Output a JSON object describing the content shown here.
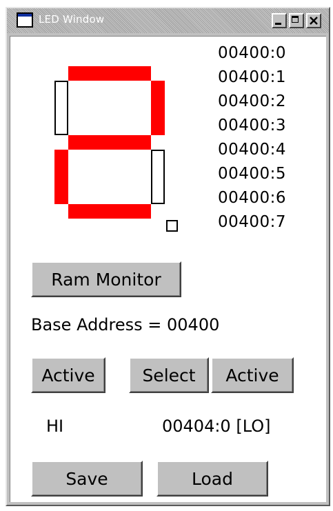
{
  "window": {
    "title": "LED Window",
    "icon": "window-icon",
    "controls": [
      "minimize-icon",
      "maximize-icon",
      "close-icon"
    ]
  },
  "segment_display": {
    "segments": {
      "a": "on",
      "b": "on",
      "c": "off",
      "d": "on",
      "e": "on",
      "f": "off",
      "g": "on",
      "dp": "off"
    },
    "colors": {
      "on": "#ff0000",
      "off": "#ffffff"
    }
  },
  "addresses": [
    "00400:0",
    "00400:1",
    "00400:2",
    "00400:3",
    "00400:4",
    "00400:5",
    "00400:6",
    "00400:7"
  ],
  "buttons": {
    "ram_monitor": "Ram Monitor",
    "active_left": "Active",
    "select": "Select",
    "active_right": "Active",
    "save": "Save",
    "load": "Load"
  },
  "base_address": "Base Address = 00400",
  "hi_label": "HI",
  "lo_address": "00404:0 [LO]"
}
